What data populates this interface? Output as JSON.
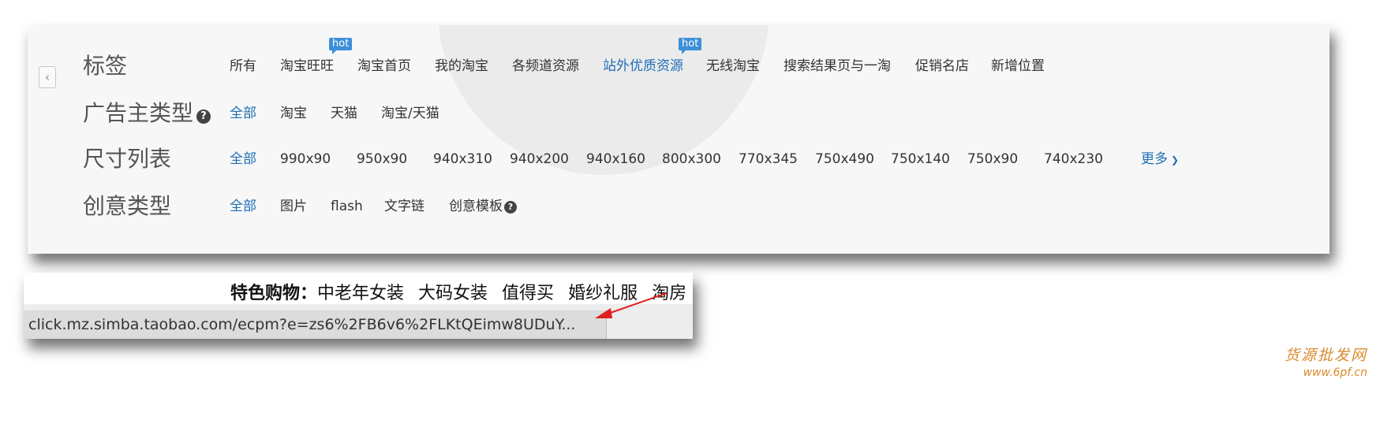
{
  "filter_panel": {
    "back_icon": "chevron-left-icon",
    "tags": {
      "label": "标签",
      "options": [
        {
          "text": "所有",
          "hot": false
        },
        {
          "text": "淘宝旺旺",
          "hot": true
        },
        {
          "text": "淘宝首页",
          "hot": false
        },
        {
          "text": "我的淘宝",
          "hot": false
        },
        {
          "text": "各频道资源",
          "hot": false
        },
        {
          "text": "站外优质资源",
          "hot": true,
          "active": true
        },
        {
          "text": "无线淘宝",
          "hot": false
        },
        {
          "text": "搜索结果页与一淘",
          "hot": false
        },
        {
          "text": "促销名店",
          "hot": false
        },
        {
          "text": "新增位置",
          "hot": false
        }
      ],
      "hot_badge": "hot"
    },
    "advertiser_type": {
      "label": "广告主类型",
      "help_icon": "question-circle-icon",
      "options": [
        "全部",
        "淘宝",
        "天猫",
        "淘宝/天猫"
      ]
    },
    "size_list": {
      "label": "尺寸列表",
      "options": [
        "全部",
        "990x90",
        "950x90",
        "940x310",
        "940x200",
        "940x160",
        "800x300",
        "770x345",
        "750x490",
        "750x140",
        "750x90",
        "740x230"
      ],
      "more_label": "更多",
      "more_icon": "chevron-down-icon"
    },
    "creative_type": {
      "label": "创意类型",
      "options": [
        "全部",
        "图片",
        "flash",
        "文字链",
        "创意模板"
      ],
      "help_icon": "question-circle-icon"
    },
    "accent_color": "#1f6eb8",
    "hot_color": "#3c8fd8"
  },
  "browser_crop": {
    "shop_title": "特色购物：",
    "shop_items": [
      "中老年女装",
      "大码女装",
      "值得买",
      "婚纱礼服",
      "淘房"
    ],
    "status_url": "click.mz.simba.taobao.com/ecpm?e=zs6%2FB6v6%2FLKtQEimw8UDuY...",
    "arrow_color": "#e02020"
  },
  "watermark": {
    "cn": "货源批发网",
    "url": "www.6pf.cn"
  }
}
